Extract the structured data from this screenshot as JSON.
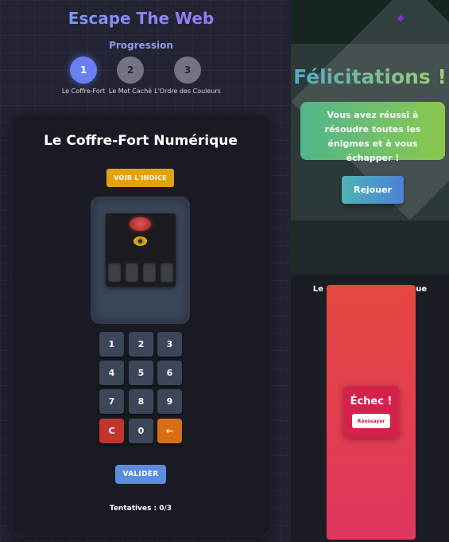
{
  "app": {
    "title": "Escape The Web"
  },
  "progress": {
    "title": "Progression",
    "steps": [
      {
        "number": "1",
        "label": "Le Coffre-Fort",
        "active": true
      },
      {
        "number": "2",
        "label": "Le Mot Caché",
        "active": false
      },
      {
        "number": "3",
        "label": "L'Ordre des Couleurs",
        "active": false
      }
    ]
  },
  "game": {
    "title": "Le Coffre-Fort Numérique",
    "hint_label": "VOIR L'INDICE",
    "keys": [
      "1",
      "2",
      "3",
      "4",
      "5",
      "6",
      "7",
      "8",
      "9",
      "C",
      "0",
      "←"
    ],
    "validate_label": "VALIDER",
    "attempts": "Tentatives : 0/3"
  },
  "success": {
    "title": "Félicitations !",
    "message": "Vous avez réussi à résoudre toutes les énigmes et à vous échapper !",
    "replay_label": "Rejouer"
  },
  "failure": {
    "behind_title": "Le Coffre-Fort Numérique",
    "title": "Échec !",
    "retry_label": "Réessayer"
  },
  "colors": {
    "accent": "#6a7ff0",
    "hint": "#e2a20c",
    "validate": "#5b8cdd",
    "clear": "#c2352f",
    "backspace": "#d96f14",
    "fail": "#e0365f",
    "success_gradient": [
      "#52b58c",
      "#8bc94e"
    ]
  }
}
